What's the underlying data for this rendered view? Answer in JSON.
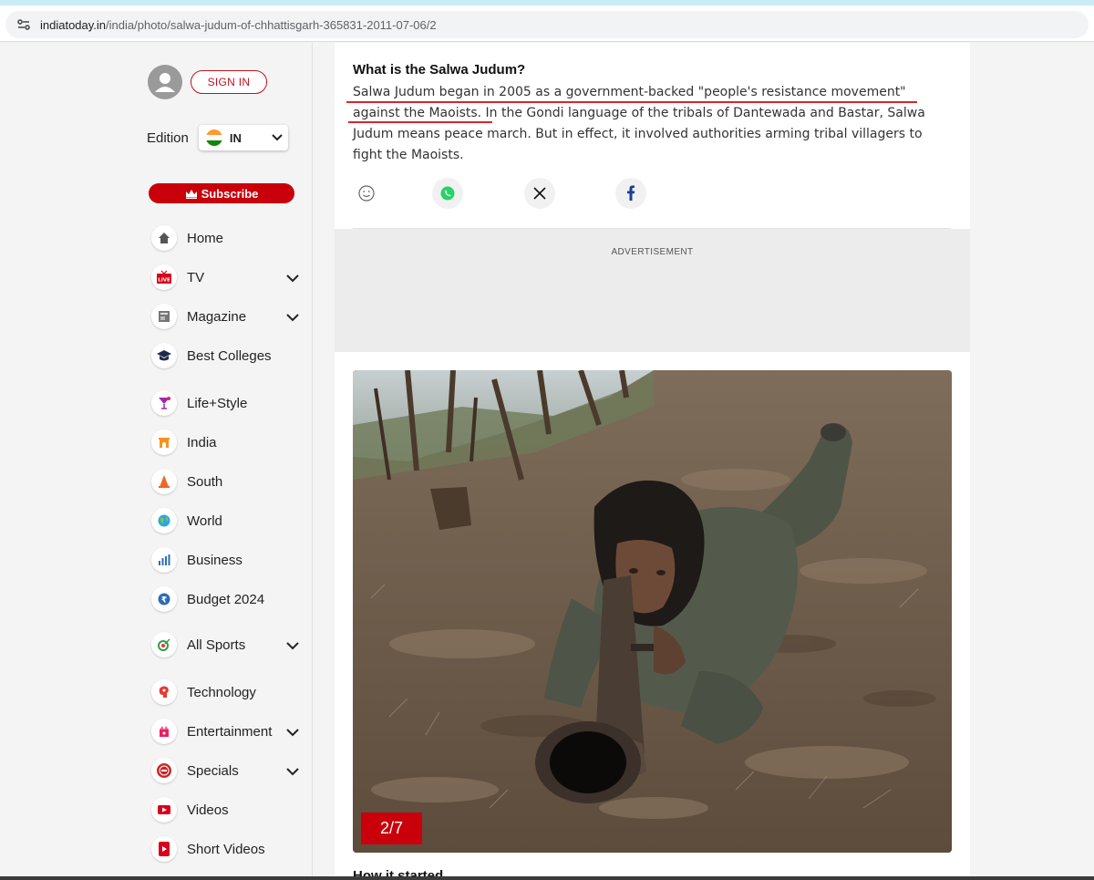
{
  "browser": {
    "url_domain": "indiatoday.in",
    "url_path": "/india/photo/salwa-judum-of-chhattisgarh-365831-2011-07-06/2"
  },
  "sidebar": {
    "signin_label": "SIGN IN",
    "edition_label": "Edition",
    "edition_value": "IN",
    "subscribe_label": "Subscribe",
    "nav": [
      {
        "label": "Home",
        "icon": "home-icon"
      },
      {
        "label": "TV",
        "icon": "live-tv-icon"
      },
      {
        "label": "Magazine",
        "icon": "magazine-icon"
      },
      {
        "label": "Best Colleges",
        "icon": "graduation-cap-icon"
      },
      {
        "label": "Life+Style",
        "icon": "cocktail-icon"
      },
      {
        "label": "India",
        "icon": "india-gate-icon"
      },
      {
        "label": "South",
        "icon": "temple-icon"
      },
      {
        "label": "World",
        "icon": "globe-icon"
      },
      {
        "label": "Business",
        "icon": "bar-chart-icon"
      },
      {
        "label": "Budget 2024",
        "icon": "rupee-coin-icon"
      },
      {
        "label": "All Sports",
        "icon": "sports-icon"
      },
      {
        "label": "Technology",
        "icon": "brain-chip-icon"
      },
      {
        "label": "Entertainment",
        "icon": "entertainment-icon"
      },
      {
        "label": "Specials",
        "icon": "specials-badge-icon"
      },
      {
        "label": "Videos",
        "icon": "video-play-icon"
      },
      {
        "label": "Short Videos",
        "icon": "mobile-video-icon"
      }
    ]
  },
  "article": {
    "question": "What is the Salwa Judum?",
    "paragraph": "Salwa Judum began in 2005 as a government-backed \"people's resistance movement\" against the Maoists. In the Gondi language of the tribals of Dantewada and Bastar, Salwa Judum means peace march. But in effect, it involved authorities arming tribal villagers to fight the Maoists.",
    "advertisement_label": "ADVERTISEMENT",
    "photo_counter": "2/7",
    "next_heading": "How it started"
  },
  "colors": {
    "brand_red": "#c9000b",
    "underline_red": "#d7262e",
    "whatsapp_green": "#25d366",
    "facebook_blue": "#1c3f94"
  }
}
